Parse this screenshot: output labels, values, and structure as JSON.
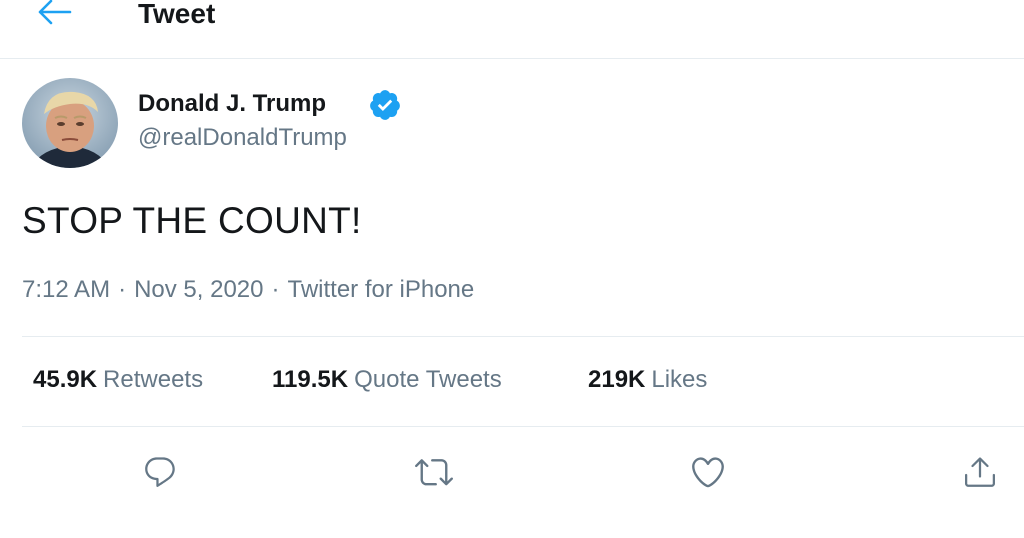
{
  "header": {
    "title": "Tweet",
    "back_icon": "arrow-left-icon"
  },
  "author": {
    "display_name": "Donald J. Trump",
    "handle": "@realDonaldTrump",
    "verified_icon": "verified-badge-icon"
  },
  "tweet": {
    "text": "STOP THE COUNT!"
  },
  "meta": {
    "time": "7:12 AM",
    "separator": "·",
    "date": "Nov 5, 2020",
    "source": "Twitter for iPhone"
  },
  "stats": {
    "retweets_count": "45.9K",
    "retweets_label": "Retweets",
    "quotes_count": "119.5K",
    "quotes_label": "Quote Tweets",
    "likes_count": "219K",
    "likes_label": "Likes"
  },
  "actions": {
    "reply_icon": "reply-icon",
    "retweet_icon": "retweet-icon",
    "like_icon": "heart-icon",
    "share_icon": "share-icon"
  },
  "colors": {
    "accent": "#1da1f2",
    "text_primary": "#14171a",
    "text_secondary": "#657786",
    "divider": "#e6ecf0"
  }
}
